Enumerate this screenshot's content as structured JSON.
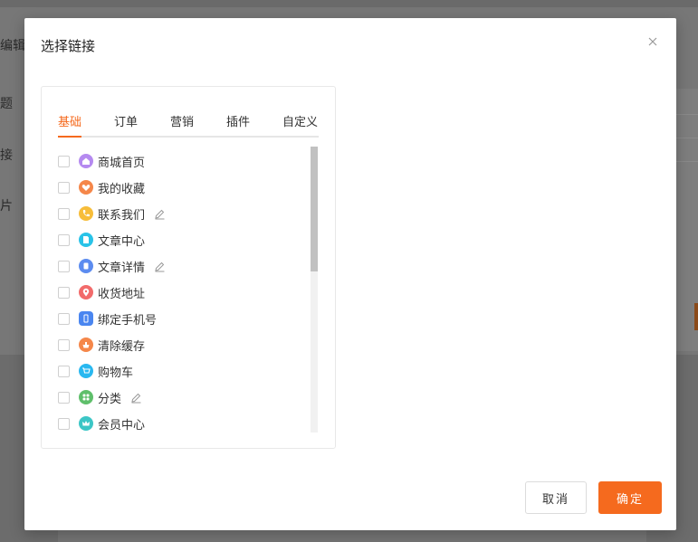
{
  "background": {
    "side_labels": [
      "编辑",
      "题",
      "接",
      "片"
    ]
  },
  "modal": {
    "title": "选择链接",
    "close_icon": "close-icon",
    "tabs": [
      {
        "label": "基础",
        "active": true
      },
      {
        "label": "订单",
        "active": false
      },
      {
        "label": "营销",
        "active": false
      },
      {
        "label": "插件",
        "active": false
      },
      {
        "label": "自定义",
        "active": false
      }
    ],
    "links": [
      {
        "label": "商城首页",
        "icon": "home-icon",
        "color": "#b58af0",
        "editable": false
      },
      {
        "label": "我的收藏",
        "icon": "heart-icon",
        "color": "#f5874a",
        "editable": false
      },
      {
        "label": "联系我们",
        "icon": "phone-icon",
        "color": "#f7bd3a",
        "editable": true
      },
      {
        "label": "文章中心",
        "icon": "document-icon",
        "color": "#29c3e8",
        "editable": false
      },
      {
        "label": "文章详情",
        "icon": "article-icon",
        "color": "#5c8cf0",
        "editable": true
      },
      {
        "label": "收货地址",
        "icon": "location-icon",
        "color": "#f26b6b",
        "editable": false
      },
      {
        "label": "绑定手机号",
        "icon": "mobile-icon",
        "color": "#4a86f0",
        "editable": false
      },
      {
        "label": "清除缓存",
        "icon": "broom-icon",
        "color": "#f5874a",
        "editable": false
      },
      {
        "label": "购物车",
        "icon": "cart-icon",
        "color": "#29b8f0",
        "editable": false
      },
      {
        "label": "分类",
        "icon": "grid-icon",
        "color": "#5fbf6b",
        "editable": true
      },
      {
        "label": "会员中心",
        "icon": "crown-icon",
        "color": "#3cc6c6",
        "editable": false
      }
    ],
    "cancel_label": "取消",
    "ok_label": "确定",
    "accent_color": "#f56a1e"
  }
}
